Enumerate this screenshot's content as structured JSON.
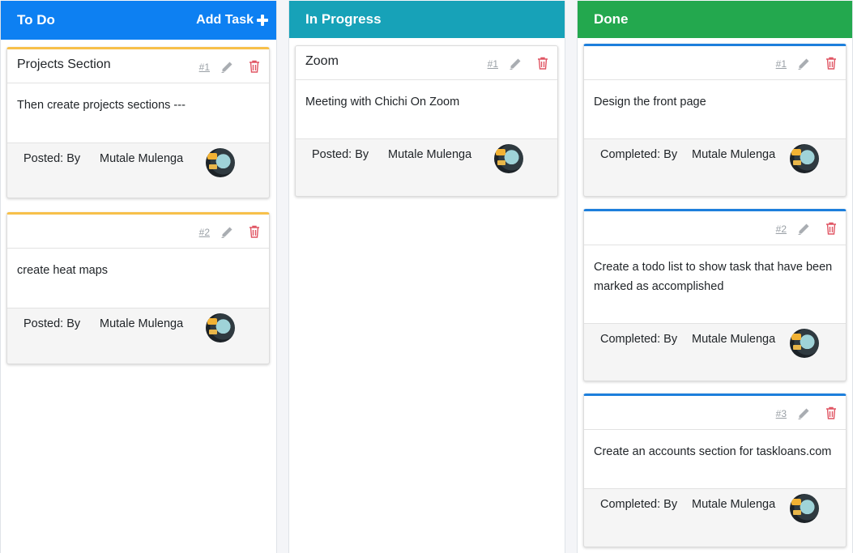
{
  "colors": {
    "todo": "#0d80f2",
    "in_progress": "#17a2b8",
    "done": "#23a84e",
    "accent_yellow": "#f7c04a",
    "accent_blue": "#1d7fdc",
    "delete_red": "#e05563",
    "icon_grey": "#a9adb2"
  },
  "columns": [
    {
      "title": "To Do",
      "add_label": "Add Task",
      "add_icon": "plus-icon",
      "cards": [
        {
          "title": "Projects Section",
          "number": "#1",
          "body": "Then create projects sections ---",
          "footer_label": "Posted: By",
          "author": "Mutale Mulenga",
          "edit_icon": "pencil-icon",
          "delete_icon": "trash-icon"
        },
        {
          "title": "",
          "number": "#2",
          "body": "create heat maps",
          "footer_label": "Posted: By",
          "author": "Mutale Mulenga",
          "edit_icon": "pencil-icon",
          "delete_icon": "trash-icon"
        }
      ]
    },
    {
      "title": "In Progress",
      "cards": [
        {
          "title": "Zoom",
          "number": "#1",
          "body": "Meeting with Chichi On Zoom",
          "footer_label": "Posted: By",
          "author": "Mutale Mulenga",
          "edit_icon": "pencil-icon",
          "delete_icon": "trash-icon"
        }
      ]
    },
    {
      "title": "Done",
      "cards": [
        {
          "title": "",
          "number": "#1",
          "body": "Design the front page",
          "footer_label": "Completed: By",
          "author": "Mutale Mulenga",
          "edit_icon": "pencil-icon",
          "delete_icon": "trash-icon"
        },
        {
          "title": "",
          "number": "#2",
          "body": "Create a todo list to show task that have been marked as accomplished",
          "footer_label": "Completed: By",
          "author": "Mutale Mulenga",
          "edit_icon": "pencil-icon",
          "delete_icon": "trash-icon"
        },
        {
          "title": "",
          "number": "#3",
          "body": "Create an accounts section for taskloans.com",
          "footer_label": "Completed: By",
          "author": "Mutale Mulenga",
          "edit_icon": "pencil-icon",
          "delete_icon": "trash-icon"
        }
      ]
    }
  ]
}
